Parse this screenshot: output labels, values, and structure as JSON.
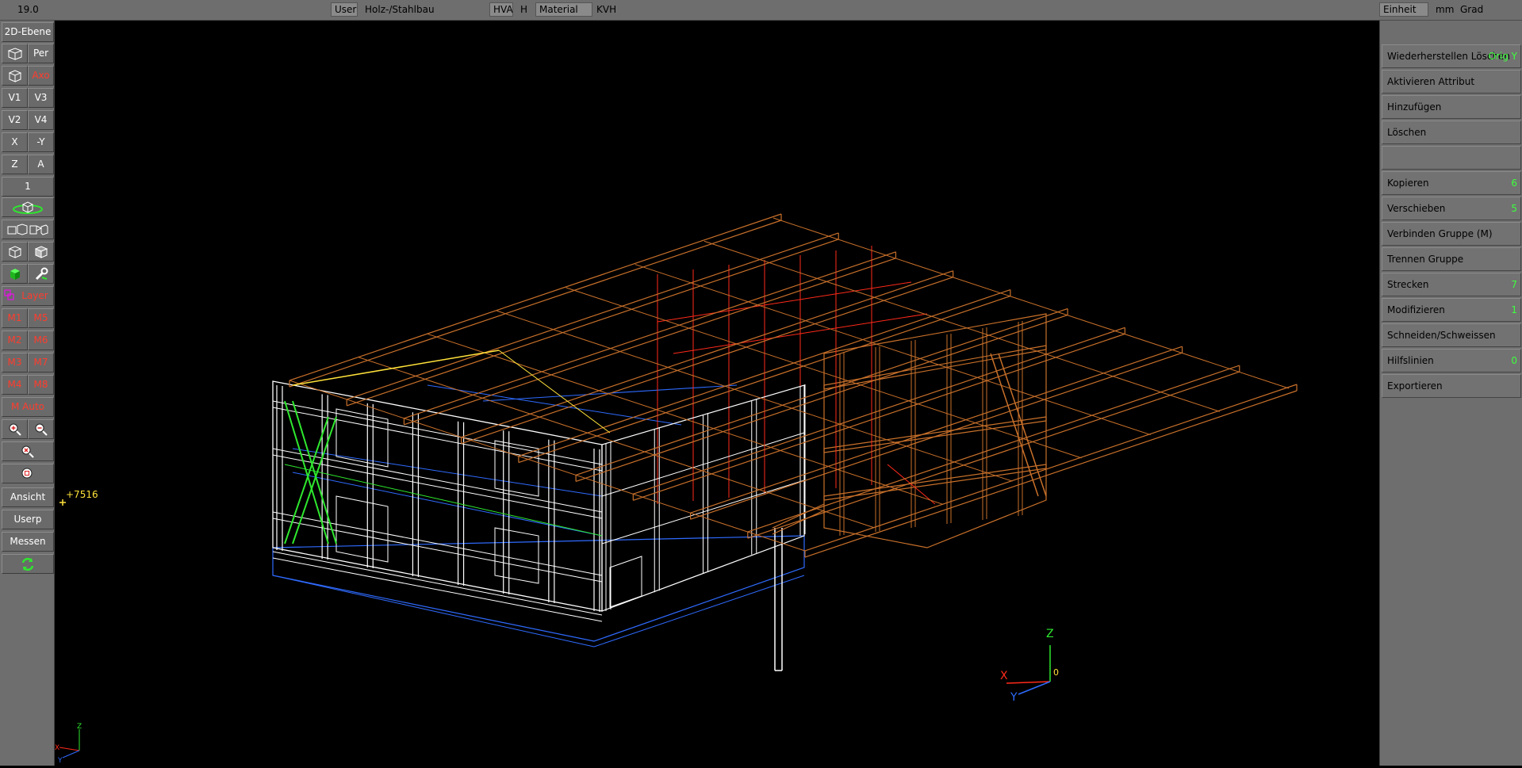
{
  "topbar": {
    "version": "19.0",
    "user_label": "User",
    "mode_value": "Holz-/Stahlbau",
    "hva_label": "HVA",
    "h_label": "H",
    "material_label": "Material",
    "material_value": "KVH",
    "unit_label": "Einheit",
    "unit_length": "mm",
    "unit_angle": "Grad"
  },
  "left_toolbar": {
    "plane_2d": "2D-Ebene",
    "per": "Per",
    "axo": "Axo",
    "v1": "V1",
    "v3": "V3",
    "v2": "V2",
    "v4": "V4",
    "x": "X",
    "neg_y": "-Y",
    "z": "Z",
    "a": "A",
    "one": "1",
    "layer": "Layer",
    "m1": "M1",
    "m5": "M5",
    "m2": "M2",
    "m6": "M6",
    "m3": "M3",
    "m7": "M7",
    "m4": "M4",
    "m8": "M8",
    "m_auto": "M Auto",
    "ansicht": "Ansicht",
    "userp": "Userp",
    "messen": "Messen"
  },
  "right_panel": {
    "restore_delete": "Wiederherstellen Löschen",
    "orig_y": "Orig Y",
    "activate_attr": "Aktivieren Attribut",
    "add": "Hinzufügen",
    "delete": "Löschen",
    "copy": "Kopieren",
    "copy_count": "6",
    "move": "Verschieben",
    "move_count": "5",
    "connect_group": "Verbinden Gruppe (M)",
    "split_group": "Trennen Gruppe",
    "stretch": "Strecken",
    "stretch_count": "7",
    "modify": "Modifizieren",
    "modify_count": "1",
    "cut_weld": "Schneiden/Schweissen",
    "helplines": "Hilfslinien",
    "helplines_count": "0",
    "export": "Exportieren"
  },
  "viewport": {
    "coord_readout": "+7516",
    "axis_z": "Z",
    "axis_x": "X",
    "axis_y": "Y",
    "axis_origin": "0",
    "mini_z": "Z",
    "mini_x": "X",
    "mini_y": "Y"
  },
  "colors": {
    "frame_white": "#ffffff",
    "timber_orange": "#c8702a",
    "bracing_green": "#2ee82e",
    "foundation_blue": "#2f6bff",
    "hidden_red": "#ff2a1a",
    "accent_yellow": "#ffe23a",
    "count_green": "#3dff3d"
  },
  "icons": [
    "perspective-icon",
    "axo-cube-icon",
    "rotate-cube-icon",
    "view-strip-icon",
    "wire-cube-icon",
    "solid-cube-icon",
    "green-cube-icon",
    "wrench-icon",
    "layer-icon",
    "zoom-in-icon",
    "zoom-out-icon",
    "zoom-window-icon",
    "zoom-all-icon",
    "refresh-icon"
  ]
}
